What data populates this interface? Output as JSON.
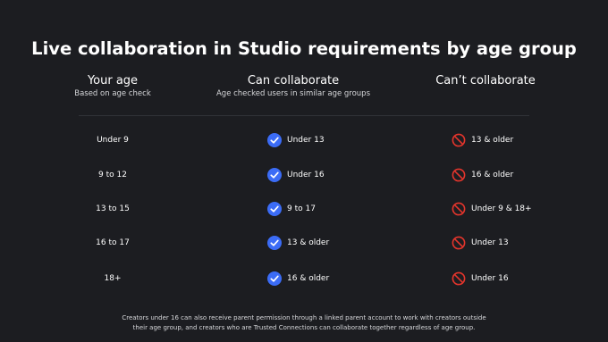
{
  "title": "Live collaboration in Studio requirements by age group",
  "columns": {
    "your_age": {
      "label": "Your age",
      "sub": "Based on age check"
    },
    "can": {
      "label": "Can collaborate",
      "sub": "Age checked users in similar age groups"
    },
    "cant": {
      "label": "Can’t collaborate"
    }
  },
  "rows": [
    {
      "age": "Under 9",
      "can": "Under 13",
      "cant": "13 & older"
    },
    {
      "age": "9 to 12",
      "can": "Under 16",
      "cant": "16 & older"
    },
    {
      "age": "13 to 15",
      "can": "9 to 17",
      "cant": "Under 9 & 18+"
    },
    {
      "age": "16 to 17",
      "can": "13 & older",
      "cant": "Under 13"
    },
    {
      "age": "18+",
      "can": "16 & older",
      "cant": "Under 16"
    }
  ],
  "footnote": {
    "line1": "Creators under 16 can also receive parent permission through a linked parent account to work with creators outside",
    "line2": "their age group, and creators who are Trusted Connections can collaborate together regardless of age group."
  },
  "icons": {
    "can": "check-circle-icon",
    "cant": "prohibited-icon"
  },
  "colors": {
    "background": "#1c1d21",
    "check": "#3b6cf6",
    "prohibited": "#e5352c"
  }
}
